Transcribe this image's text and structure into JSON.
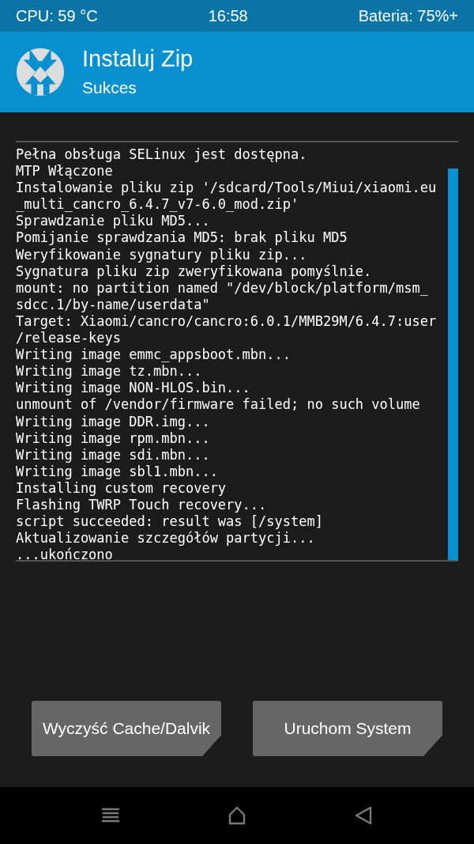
{
  "status_bar": {
    "cpu": "CPU: 59 °C",
    "time": "16:58",
    "battery": "Bateria: 75%+"
  },
  "header": {
    "title": "Instaluj Zip",
    "subtitle": "Sukces"
  },
  "console": {
    "lines": [
      "Pełna obsługa SELinux jest dostępna.",
      "MTP Włączone",
      "Instalowanie pliku zip '/sdcard/Tools/Miui/xiaomi.eu",
      "_multi_cancro_6.4.7_v7-6.0_mod.zip'",
      "Sprawdzanie pliku MD5...",
      "Pomijanie sprawdzania MD5: brak pliku MD5",
      "Weryfikowanie sygnatury pliku zip...",
      "Sygnatura pliku zip zweryfikowana pomyślnie.",
      "mount: no partition named \"/dev/block/platform/msm_",
      "sdcc.1/by-name/userdata\"",
      "Target: Xiaomi/cancro/cancro:6.0.1/MMB29M/6.4.7:user",
      "/release-keys",
      "Writing image emmc_appsboot.mbn...",
      "Writing image tz.mbn...",
      "Writing image NON-HLOS.bin...",
      "unmount of /vendor/firmware failed; no such volume",
      "Writing image DDR.img...",
      "Writing image rpm.mbn...",
      "Writing image sdi.mbn...",
      "Writing image sbl1.mbn...",
      "Installing custom recovery",
      "Flashing TWRP Touch recovery...",
      "script succeeded: result was [/system]",
      "Aktualizowanie szczegółów partycji...",
      "...ukończono"
    ]
  },
  "buttons": [
    "Wyczyść Cache/Dalvik",
    "Uruchom System"
  ]
}
